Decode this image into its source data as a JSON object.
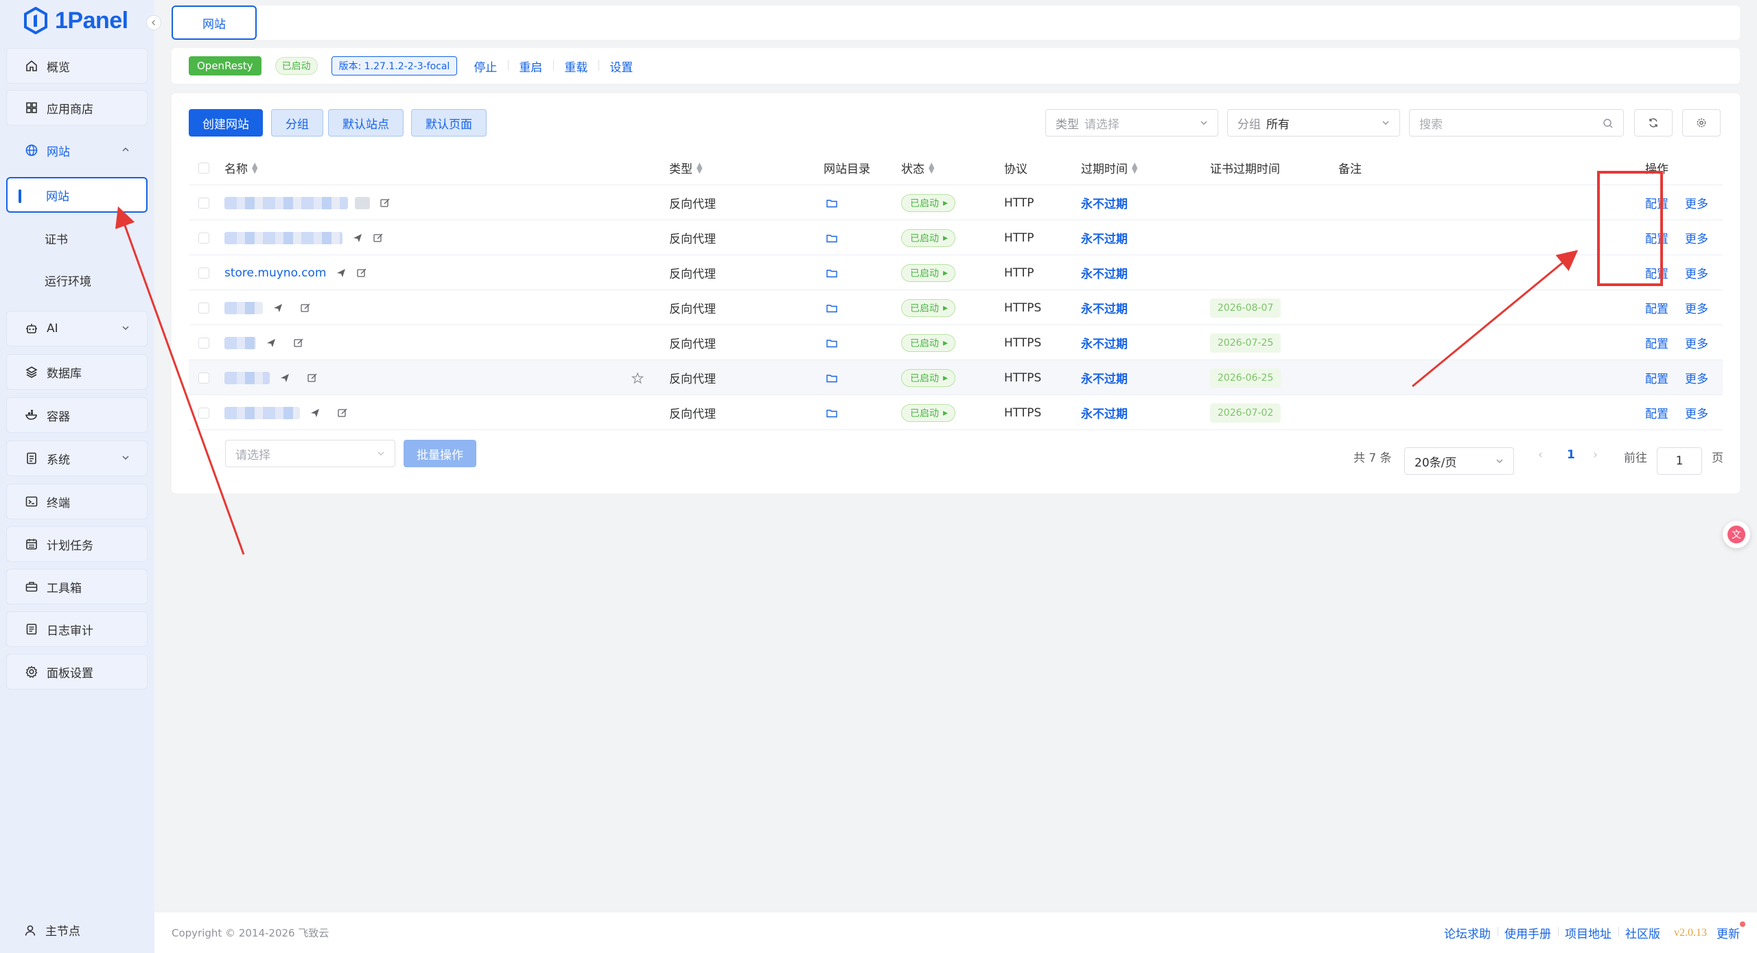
{
  "app": {
    "brand": "1Panel"
  },
  "sidebar": {
    "items": [
      {
        "label": "概览",
        "icon": "home-icon"
      },
      {
        "label": "应用商店",
        "icon": "grid-icon"
      },
      {
        "label": "网站",
        "icon": "globe-icon"
      },
      {
        "label": "AI",
        "icon": "robot-icon"
      },
      {
        "label": "数据库",
        "icon": "layers-icon"
      },
      {
        "label": "容器",
        "icon": "docker-icon"
      },
      {
        "label": "系统",
        "icon": "system-icon"
      },
      {
        "label": "终端",
        "icon": "terminal-icon"
      },
      {
        "label": "计划任务",
        "icon": "calendar-icon"
      },
      {
        "label": "工具箱",
        "icon": "toolbox-icon"
      },
      {
        "label": "日志审计",
        "icon": "log-icon"
      },
      {
        "label": "面板设置",
        "icon": "gear-icon"
      }
    ],
    "sub_items": [
      "网站",
      "证书",
      "运行环境"
    ],
    "node_label": "主节点"
  },
  "tabs": {
    "active": "网站"
  },
  "status_bar": {
    "app_name": "OpenResty",
    "running": "已启动",
    "version": "版本: 1.27.1.2-2-3-focal",
    "actions": [
      "停止",
      "重启",
      "重载",
      "设置"
    ]
  },
  "toolbar": {
    "create": "创建网站",
    "group": "分组",
    "default_site": "默认站点",
    "default_page": "默认页面",
    "type_label": "类型",
    "type_placeholder": "请选择",
    "group_label": "分组",
    "group_value": "所有",
    "search_placeholder": "搜索"
  },
  "table": {
    "headers": {
      "name": "名称",
      "type": "类型",
      "dir": "网站目录",
      "status": "状态",
      "protocol": "协议",
      "expire": "过期时间",
      "cert_expire": "证书过期时间",
      "remark": "备注",
      "ops": "操作"
    },
    "rows": [
      {
        "name": "",
        "type": "反向代理",
        "status": "已启动",
        "protocol": "HTTP",
        "expire": "永不过期",
        "cert": "",
        "op_config": "配置",
        "op_more": "更多"
      },
      {
        "name": "",
        "type": "反向代理",
        "status": "已启动",
        "protocol": "HTTP",
        "expire": "永不过期",
        "cert": "",
        "op_config": "配置",
        "op_more": "更多"
      },
      {
        "name": "store.muyno.com",
        "type": "反向代理",
        "status": "已启动",
        "protocol": "HTTP",
        "expire": "永不过期",
        "cert": "",
        "op_config": "配置",
        "op_more": "更多"
      },
      {
        "name": "",
        "type": "反向代理",
        "status": "已启动",
        "protocol": "HTTPS",
        "expire": "永不过期",
        "cert": "2026-08-07",
        "op_config": "配置",
        "op_more": "更多"
      },
      {
        "name": "",
        "type": "反向代理",
        "status": "已启动",
        "protocol": "HTTPS",
        "expire": "永不过期",
        "cert": "2026-07-25",
        "op_config": "配置",
        "op_more": "更多"
      },
      {
        "name": "",
        "type": "反向代理",
        "status": "已启动",
        "protocol": "HTTPS",
        "expire": "永不过期",
        "cert": "2026-06-25",
        "op_config": "配置",
        "op_more": "更多"
      },
      {
        "name": "",
        "type": "反向代理",
        "status": "已启动",
        "protocol": "HTTPS",
        "expire": "永不过期",
        "cert": "2026-07-02",
        "op_config": "配置",
        "op_more": "更多"
      }
    ]
  },
  "batch": {
    "placeholder": "请选择",
    "button": "批量操作"
  },
  "pagination": {
    "total": "共 7 条",
    "page_size": "20条/页",
    "current": "1",
    "goto_label": "前往",
    "goto_value": "1",
    "page_unit": "页"
  },
  "footer": {
    "copyright": "Copyright © 2014-2026 飞致云",
    "links": [
      "论坛求助",
      "使用手册",
      "项目地址",
      "社区版"
    ],
    "version": "v2.0.13",
    "update": "更新"
  },
  "colors": {
    "primary": "#1663e5",
    "success": "#4cb648",
    "annotation": "#e53935"
  }
}
